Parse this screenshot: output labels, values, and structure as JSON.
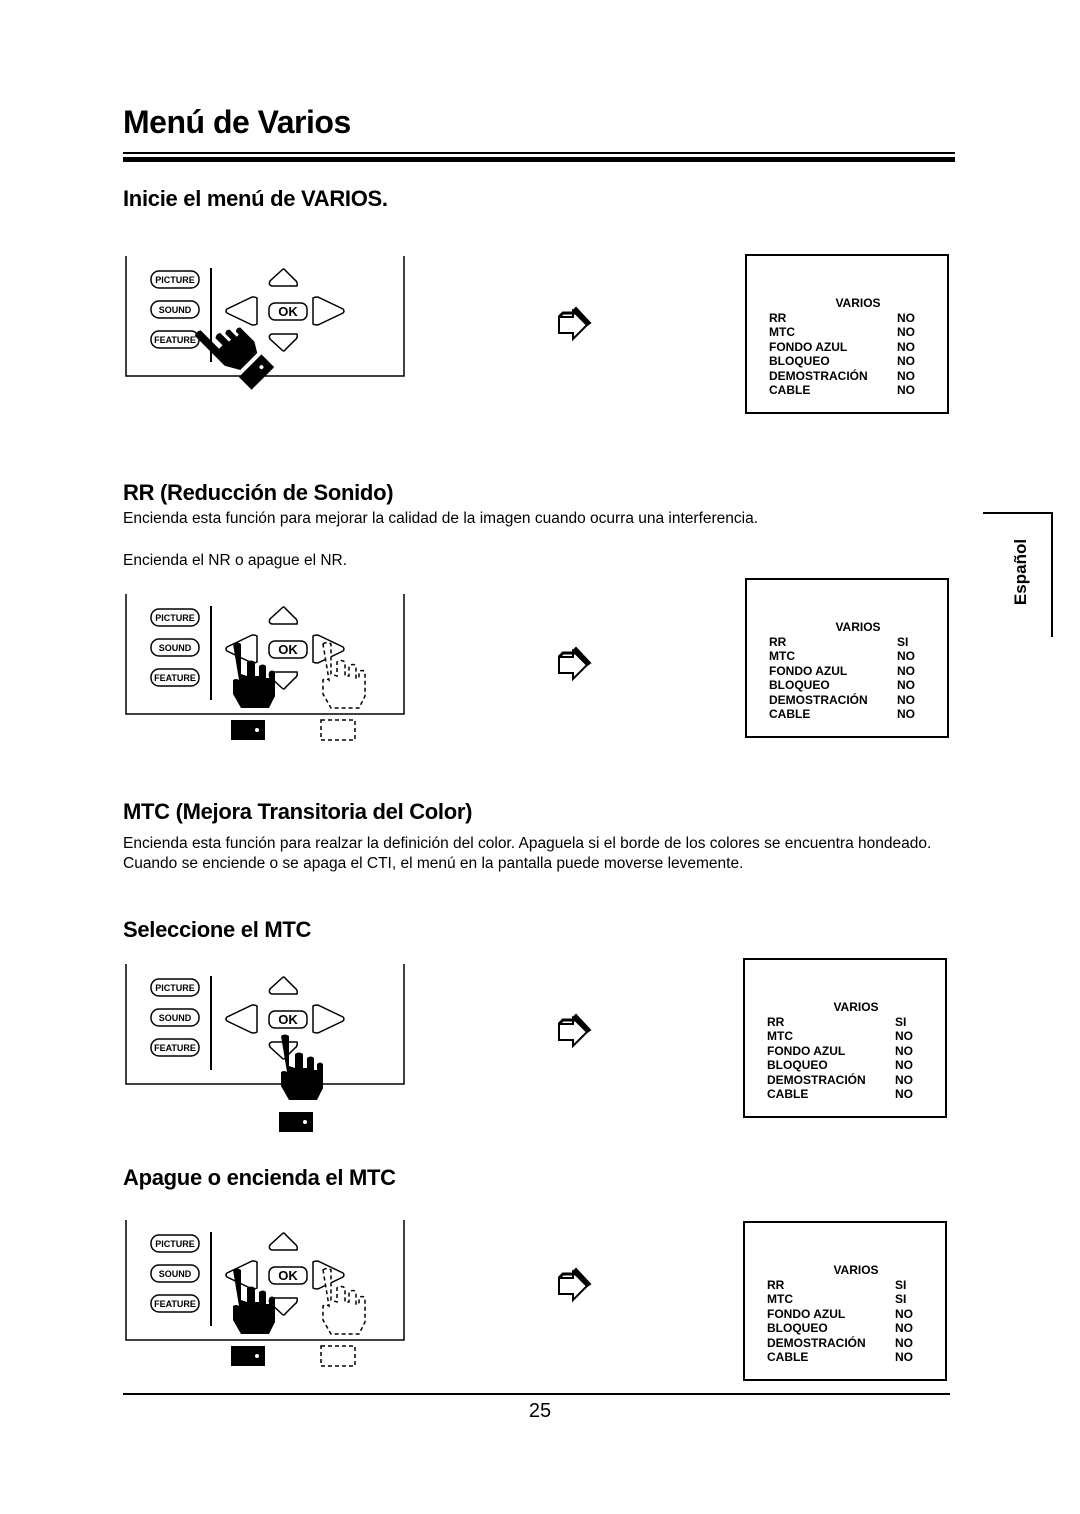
{
  "page": {
    "title": "Menú de Varios",
    "side_tab": "Español",
    "page_number": "25"
  },
  "remote": {
    "buttons": [
      "PICTURE",
      "SOUND",
      "FEATURE"
    ],
    "ok_label": "OK"
  },
  "sections": [
    {
      "heading": "Inicie el menú de VARIOS.",
      "paragraphs": [],
      "osd": {
        "title": "VARIOS",
        "rows": [
          {
            "label": "RR",
            "value": "NO"
          },
          {
            "label": "MTC",
            "value": "NO"
          },
          {
            "label": "FONDO AZUL",
            "value": "NO"
          },
          {
            "label": "BLOQUEO",
            "value": "NO"
          },
          {
            "label": "DEMOSTRACIÓN",
            "value": "NO"
          },
          {
            "label": "CABLE",
            "value": "NO"
          }
        ]
      }
    },
    {
      "heading": "RR (Reducción de Sonido)",
      "paragraphs": [
        "Encienda esta función para mejorar la calidad de la imagen cuando ocurra una interferencia.",
        "Encienda el NR  o apague el NR."
      ],
      "osd": {
        "title": "VARIOS",
        "rows": [
          {
            "label": "RR",
            "value": "SI"
          },
          {
            "label": "MTC",
            "value": "NO"
          },
          {
            "label": "FONDO AZUL",
            "value": "NO"
          },
          {
            "label": "BLOQUEO",
            "value": "NO"
          },
          {
            "label": "DEMOSTRACIÓN",
            "value": "NO"
          },
          {
            "label": "CABLE",
            "value": "NO"
          }
        ]
      }
    },
    {
      "heading": "MTC (Mejora Transitoria del Color)",
      "paragraphs": [
        "Encienda esta función para realzar la definición del color.  Apaguela si el borde de los colores se encuentra hondeado.  Cuando se enciende o se apaga  el CTI, el menú en la pantalla puede moverse levemente."
      ]
    },
    {
      "heading": "Seleccione el MTC",
      "paragraphs": [],
      "osd": {
        "title": "VARIOS",
        "rows": [
          {
            "label": "RR",
            "value": "SI"
          },
          {
            "label": "MTC",
            "value": "NO"
          },
          {
            "label": "FONDO  AZUL",
            "value": "NO"
          },
          {
            "label": "BLOQUEO",
            "value": "NO"
          },
          {
            "label": "DEMOSTRACIÓN",
            "value": "NO"
          },
          {
            "label": "CABLE",
            "value": "NO"
          }
        ]
      }
    },
    {
      "heading": "Apague o encienda el  MTC",
      "paragraphs": [],
      "osd": {
        "title": "VARIOS",
        "rows": [
          {
            "label": "RR",
            "value": "SI"
          },
          {
            "label": "MTC",
            "value": "SI"
          },
          {
            "label": "FONDO AZUL",
            "value": "NO"
          },
          {
            "label": "BLOQUEO",
            "value": "NO"
          },
          {
            "label": "DEMOSTRACIÓN",
            "value": "NO"
          },
          {
            "label": "CABLE",
            "value": "NO"
          }
        ]
      }
    }
  ]
}
